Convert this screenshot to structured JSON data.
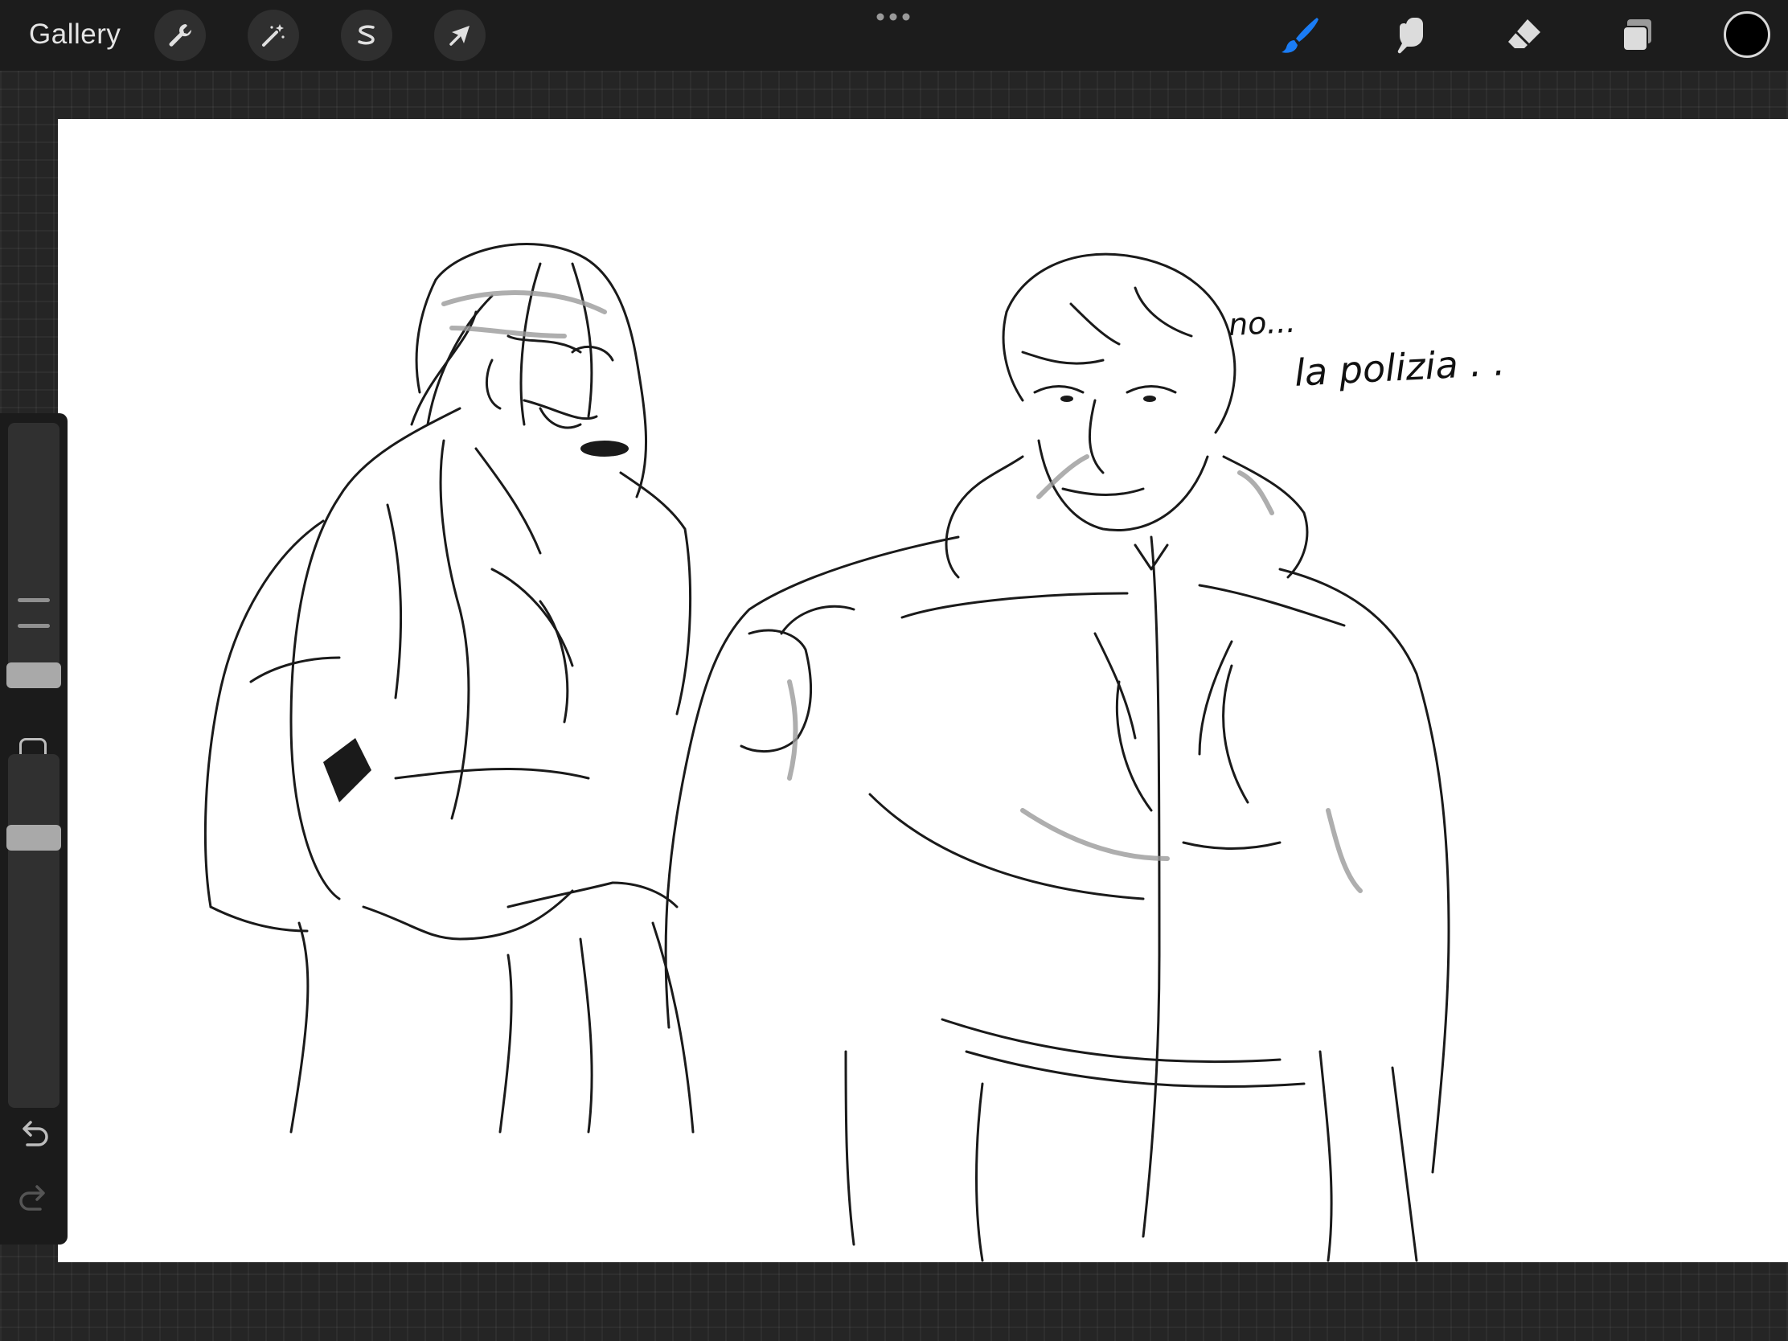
{
  "app": {
    "gallery_label": "Gallery"
  },
  "toolbar": {
    "left_tools": [
      {
        "name": "actions",
        "icon": "wrench-icon"
      },
      {
        "name": "adjustments",
        "icon": "magic-wand-icon"
      },
      {
        "name": "selection",
        "icon": "selection-s-icon"
      },
      {
        "name": "transform",
        "icon": "arrow-cursor-icon"
      }
    ],
    "right_tools": [
      {
        "name": "brush",
        "icon": "brush-icon",
        "active": true
      },
      {
        "name": "smudge",
        "icon": "smudge-finger-icon",
        "active": false
      },
      {
        "name": "eraser",
        "icon": "eraser-icon",
        "active": false
      },
      {
        "name": "layers",
        "icon": "layers-icon",
        "active": false
      }
    ],
    "active_color": "#000000",
    "accent_color": "#1a7cf5"
  },
  "canvas": {
    "handwriting_line1": "no...",
    "handwriting_line2": "la polizia . ."
  },
  "sidebar": {
    "undo_icon": "undo-icon",
    "redo_icon": "redo-icon",
    "modify_icon": "square-modify-icon"
  }
}
